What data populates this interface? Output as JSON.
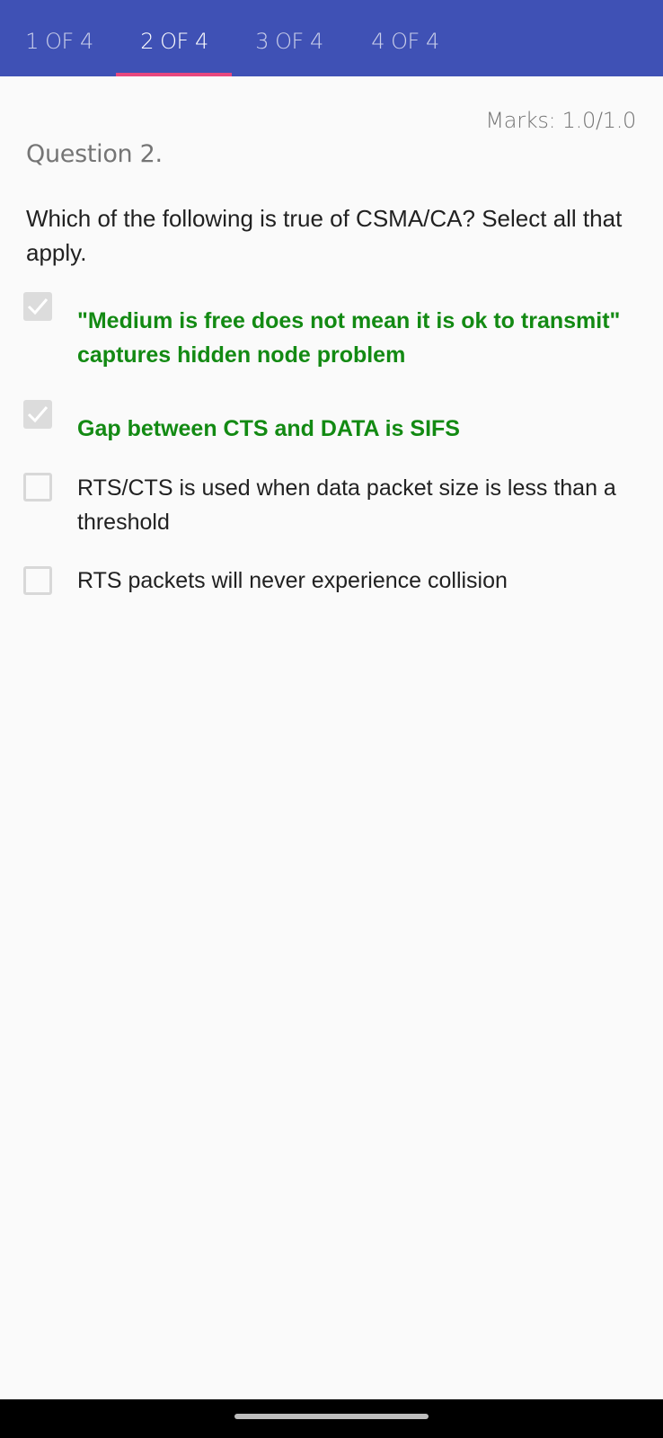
{
  "tabs": [
    {
      "label": "1 OF 4",
      "active": false
    },
    {
      "label": "2 OF 4",
      "active": true
    },
    {
      "label": "3 OF 4",
      "active": false
    },
    {
      "label": "4 OF 4",
      "active": false
    }
  ],
  "colors": {
    "tab_bar": "#3f51b5",
    "tab_indicator": "#e8487e",
    "correct_answer": "#138a13",
    "background": "#fafafa"
  },
  "marks": "Marks: 1.0/1.0",
  "question": {
    "number_label": "Question 2.",
    "text": "Which of the following is true of CSMA/CA? Select all that apply."
  },
  "options": [
    {
      "label": "\"Medium is free does not mean it is ok to transmit\" captures hidden node problem",
      "checked": true,
      "correct": true
    },
    {
      "label": "Gap between CTS and DATA is SIFS",
      "checked": true,
      "correct": true
    },
    {
      "label": "RTS/CTS is used when data packet size is less than a threshold",
      "checked": false,
      "correct": false
    },
    {
      "label": "RTS packets will never experience collision",
      "checked": false,
      "correct": false
    }
  ]
}
